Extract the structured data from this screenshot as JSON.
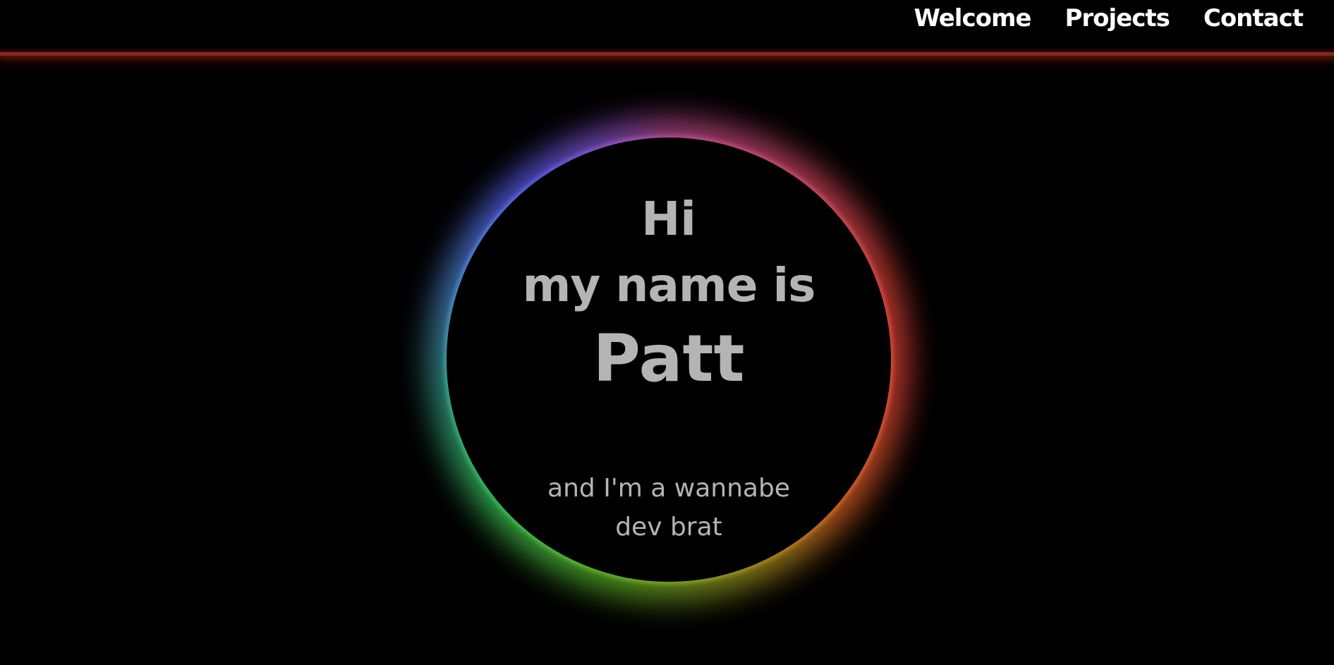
{
  "nav": {
    "items": [
      {
        "label": "Welcome"
      },
      {
        "label": "Projects"
      },
      {
        "label": "Contact"
      }
    ]
  },
  "hero": {
    "greeting": "Hi",
    "intro": "my name is",
    "name": "Patt",
    "tagline": "and I'm a wannabe dev brat"
  },
  "colors": {
    "background": "#000000",
    "nav_text": "#ffffff",
    "hero_text": "#b4b4b4",
    "nav_line_glow": "#9b2f2a",
    "ring_gradient": [
      "#b04a86",
      "#d0463a",
      "#c9602a",
      "#9a8a20",
      "#5cb22a",
      "#34b85a",
      "#38a08a",
      "#4c80c8",
      "#5a5ae0",
      "#8a52c0"
    ]
  }
}
